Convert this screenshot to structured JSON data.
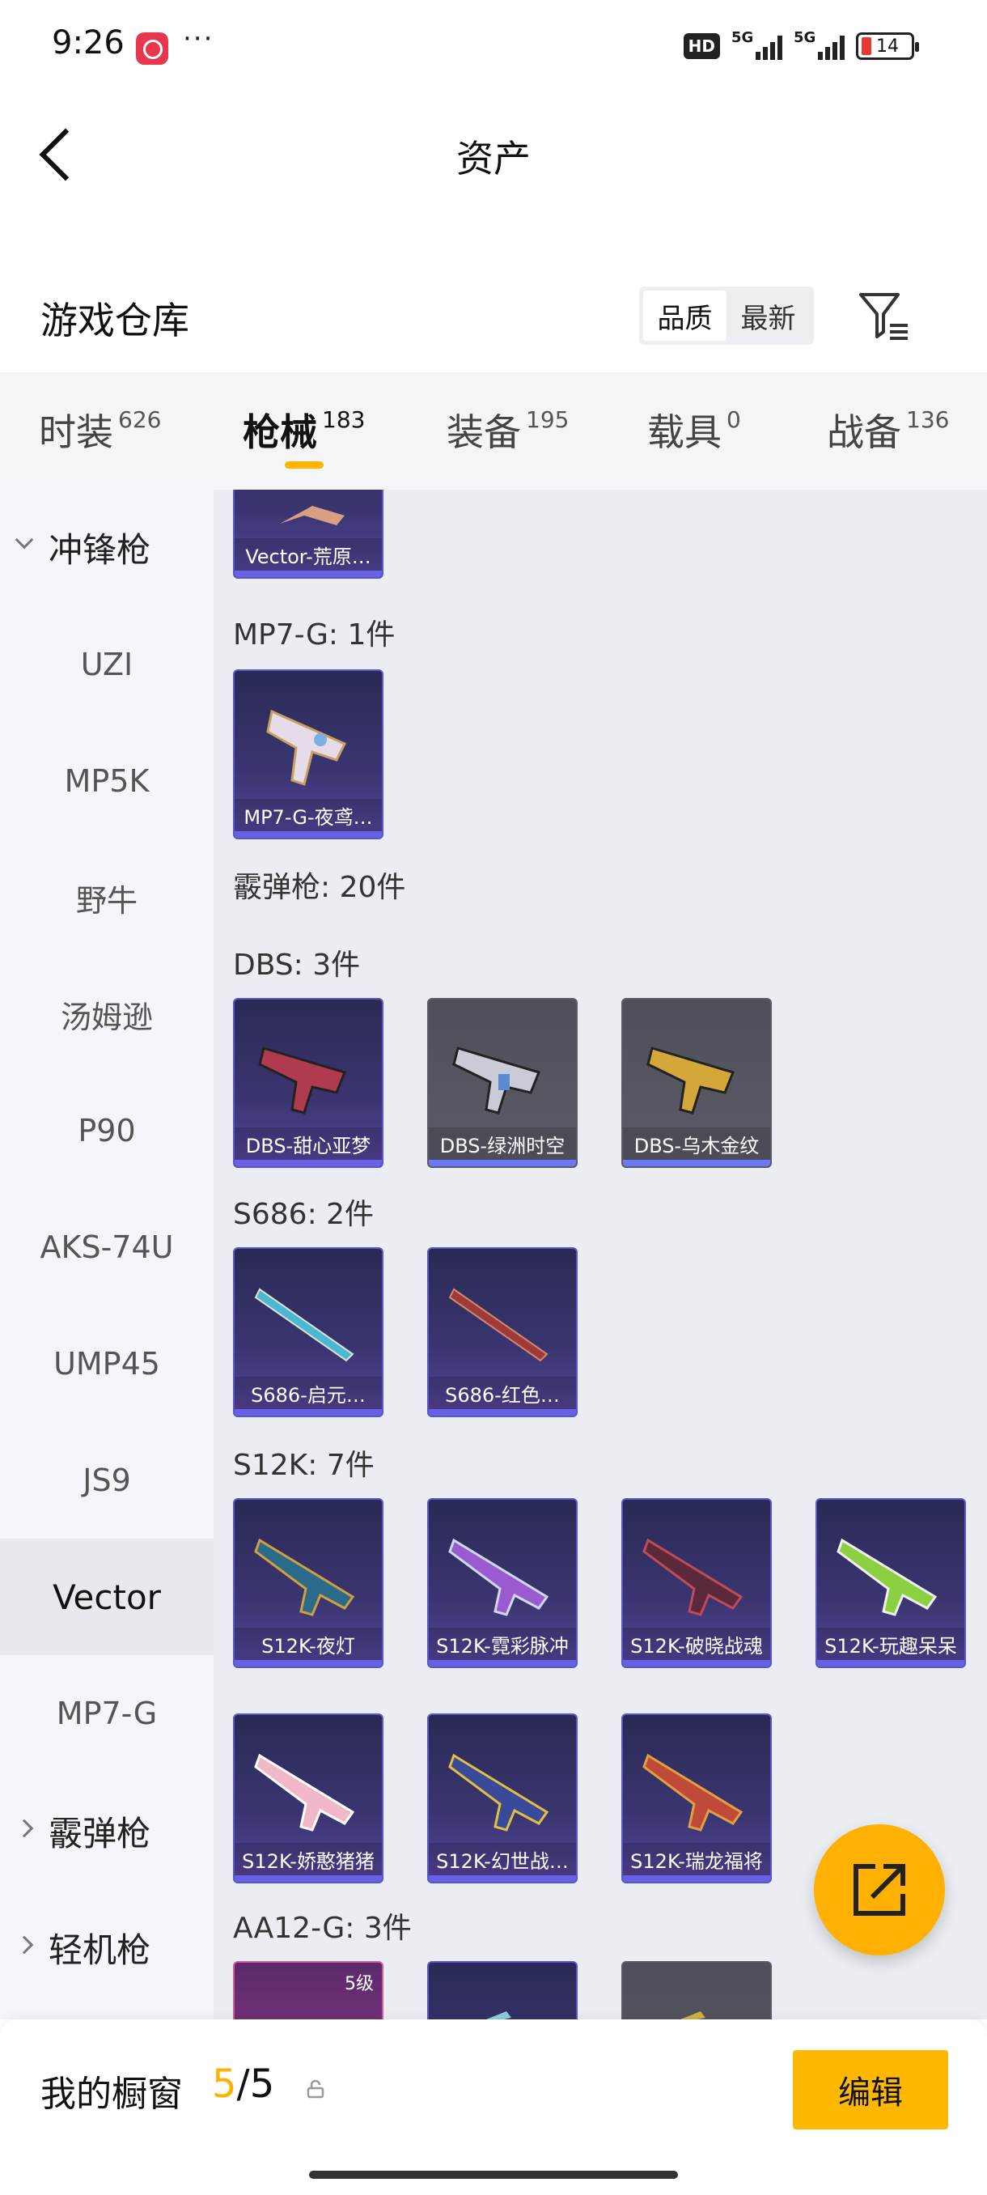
{
  "status_bar": {
    "time": "9:26",
    "dots": "···",
    "hd": "HD",
    "net1": "5G",
    "net2": "5G",
    "battery": "14"
  },
  "header": {
    "title": "资产"
  },
  "repo": {
    "title": "游戏仓库",
    "sort_quality": "品质",
    "sort_newest": "最新"
  },
  "tabs": [
    {
      "label": "时装",
      "count": "626"
    },
    {
      "label": "枪械",
      "count": "183"
    },
    {
      "label": "装备",
      "count": "195"
    },
    {
      "label": "载具",
      "count": "0"
    },
    {
      "label": "战备",
      "count": "136"
    }
  ],
  "sidebar": {
    "cat_smg": "冲锋枪",
    "sub": [
      "UZI",
      "MP5K",
      "野牛",
      "汤姆逊",
      "P90",
      "AKS-74U",
      "UMP45",
      "JS9",
      "Vector",
      "MP7-G"
    ],
    "cat_shotgun": "霰弹枪",
    "cat_lmg": "轻机枪"
  },
  "content": {
    "vector_item": "Vector-荒原…",
    "mp7_header": "MP7-G: 1件",
    "mp7_item": "MP7-G-夜鸢…",
    "shotgun_header": "霰弹枪: 20件",
    "dbs_header": "DBS: 3件",
    "dbs_items": [
      "DBS-甜心亚梦",
      "DBS-绿洲时空",
      "DBS-乌木金纹"
    ],
    "s686_header": "S686: 2件",
    "s686_items": [
      "S686-启元…",
      "S686-红色…"
    ],
    "s12k_header": "S12K: 7件",
    "s12k_items": [
      "S12K-夜灯",
      "S12K-霓彩脉冲",
      "S12K-破晓战魂",
      "S12K-玩趣呆呆",
      "S12K-娇憨猪猪",
      "S12K-幻世战…",
      "S12K-瑞龙福将"
    ],
    "aa12_header": "AA12-G: 3件",
    "aa12_level": "5级"
  },
  "bottom": {
    "label": "我的橱窗",
    "current": "5",
    "total": "/5",
    "edit": "编辑"
  },
  "colors": {
    "accent": "#ffb000",
    "card_purple": "#3a3570",
    "card_grey": "#5b5c66"
  }
}
